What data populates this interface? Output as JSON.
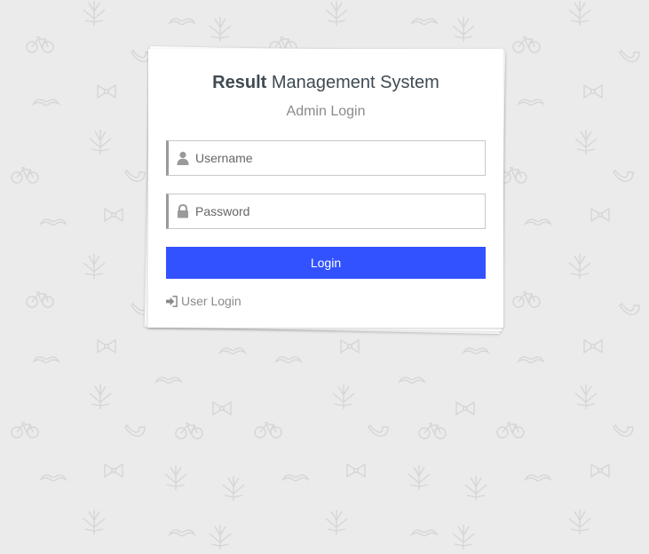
{
  "page": {
    "background_color": "#ebebeb",
    "pattern_icons": [
      "cannabis-leaf-icon",
      "bicycle-icon",
      "mustache-icon",
      "bow-tie-icon",
      "pipe-icon"
    ]
  },
  "login_card": {
    "title_bold": "Result",
    "title_rest": "Management System",
    "subtitle": "Admin Login",
    "username": {
      "placeholder": "Username",
      "value": "",
      "icon": "user-icon"
    },
    "password": {
      "placeholder": "Password",
      "value": "",
      "icon": "lock-icon"
    },
    "login_button": {
      "label": "Login",
      "color": "#3352ff"
    },
    "user_login_link": {
      "label": "User Login",
      "icon": "sign-in-icon"
    }
  }
}
